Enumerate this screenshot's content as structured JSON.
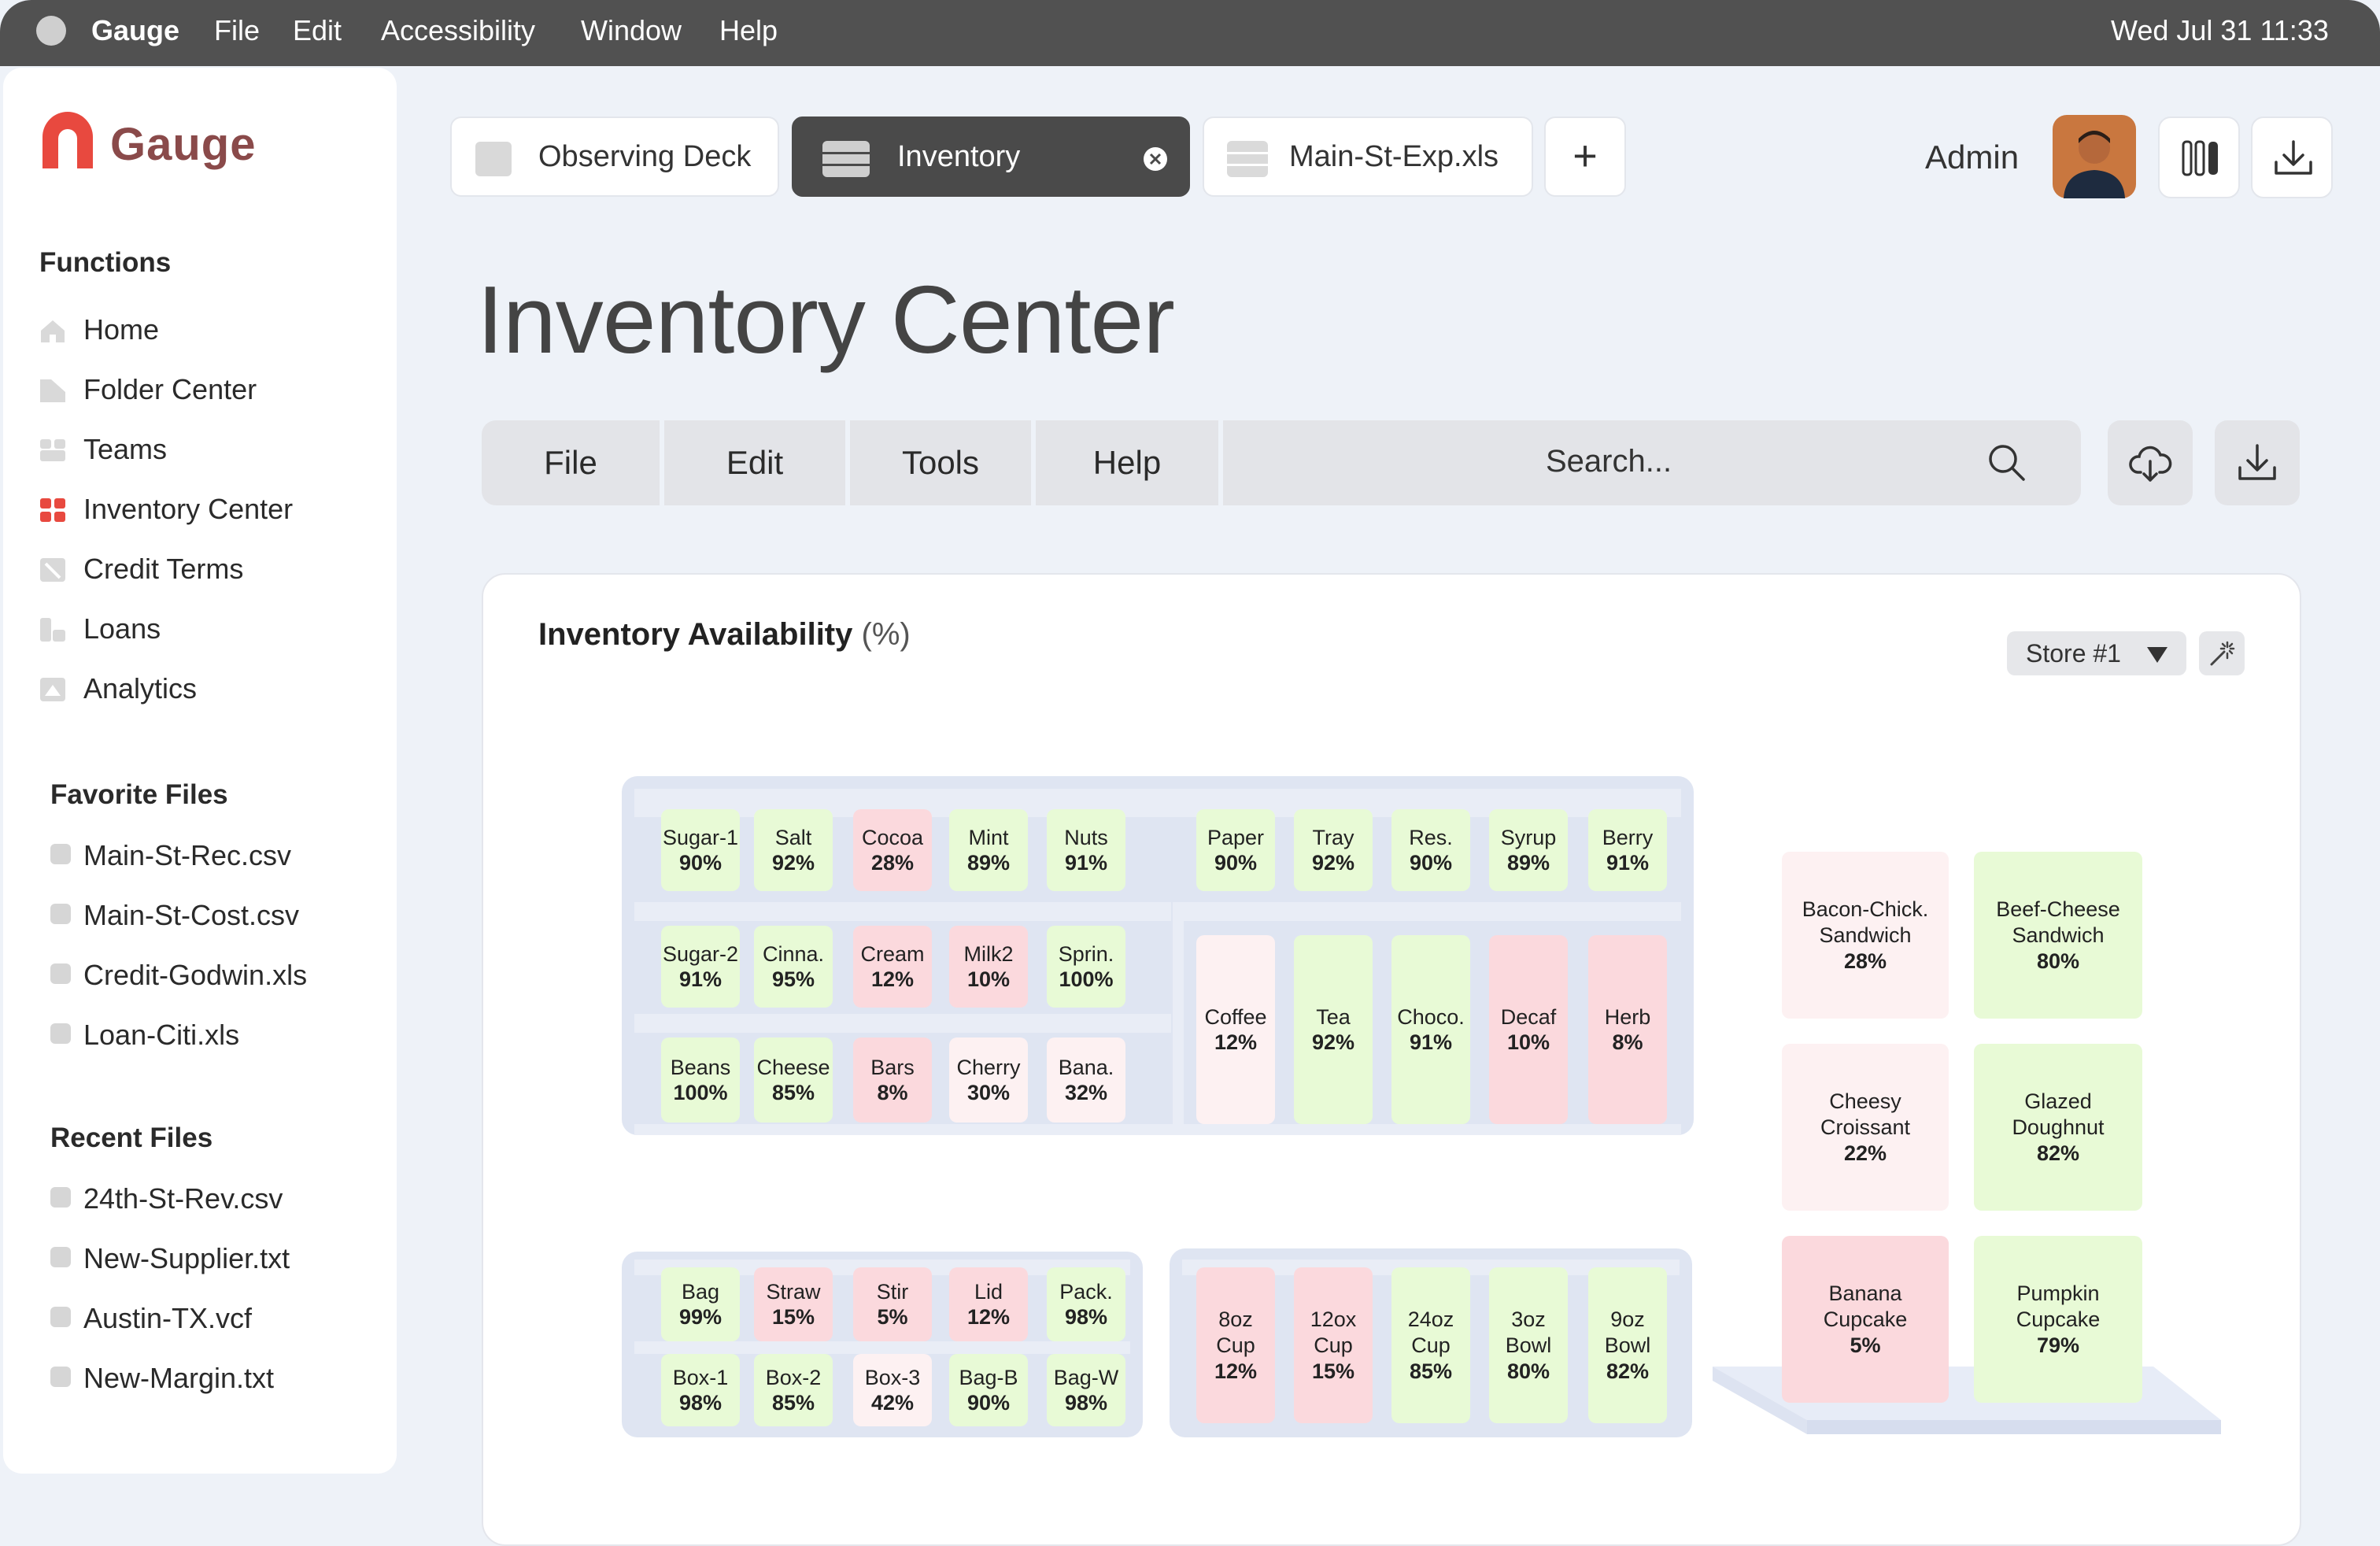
{
  "menubar": {
    "app": "Gauge",
    "items": [
      "File",
      "Edit",
      "Accessibility",
      "Window",
      "Help"
    ],
    "datetime": "Wed Jul 31  11:33"
  },
  "sidebar": {
    "brand": "Gauge",
    "functions_title": "Functions",
    "functions": [
      {
        "label": "Home",
        "icon": "home-icon"
      },
      {
        "label": "Folder Center",
        "icon": "folder-icon"
      },
      {
        "label": "Teams",
        "icon": "teams-icon"
      },
      {
        "label": "Inventory Center",
        "icon": "grid-icon",
        "active": true
      },
      {
        "label": "Credit Terms",
        "icon": "credit-icon"
      },
      {
        "label": "Loans",
        "icon": "loans-icon"
      },
      {
        "label": "Analytics",
        "icon": "analytics-icon"
      }
    ],
    "favorites_title": "Favorite Files",
    "favorites": [
      "Main-St-Rec.csv",
      "Main-St-Cost.csv",
      "Credit-Godwin.xls",
      "Loan-Citi.xls"
    ],
    "recent_title": "Recent Files",
    "recent": [
      "24th-St-Rev.csv",
      "New-Supplier.txt",
      "Austin-TX.vcf",
      "New-Margin.txt"
    ]
  },
  "tabs": [
    {
      "label": "Observing Deck"
    },
    {
      "label": "Inventory",
      "active": true
    },
    {
      "label": "Main-St-Exp.xls"
    }
  ],
  "header": {
    "user": "Admin",
    "add_tab": "+"
  },
  "page": {
    "title": "Inventory Center"
  },
  "toolbar": {
    "menus": [
      "File",
      "Edit",
      "Tools",
      "Help"
    ],
    "search_placeholder": "Search..."
  },
  "panel": {
    "title": "Inventory Availability",
    "unit": "(%)",
    "store": "Store #1"
  },
  "shelf_items": {
    "top_left": [
      {
        "name": "Sugar-1",
        "pct": "90%"
      },
      {
        "name": "Salt",
        "pct": "92%"
      },
      {
        "name": "Cocoa",
        "pct": "28%"
      },
      {
        "name": "Mint",
        "pct": "89%"
      },
      {
        "name": "Nuts",
        "pct": "91%"
      },
      {
        "name": "Sugar-2",
        "pct": "91%"
      },
      {
        "name": "Cinna.",
        "pct": "95%"
      },
      {
        "name": "Cream",
        "pct": "12%"
      },
      {
        "name": "Milk2",
        "pct": "10%"
      },
      {
        "name": "Sprin.",
        "pct": "100%"
      },
      {
        "name": "Beans",
        "pct": "100%"
      },
      {
        "name": "Cheese",
        "pct": "85%"
      },
      {
        "name": "Bars",
        "pct": "8%"
      },
      {
        "name": "Cherry",
        "pct": "30%"
      },
      {
        "name": "Bana.",
        "pct": "32%"
      }
    ],
    "top_right_row": [
      {
        "name": "Paper",
        "pct": "90%"
      },
      {
        "name": "Tray",
        "pct": "92%"
      },
      {
        "name": "Res.",
        "pct": "90%"
      },
      {
        "name": "Syrup",
        "pct": "89%"
      },
      {
        "name": "Berry",
        "pct": "91%"
      }
    ],
    "top_right_tall": [
      {
        "name": "Coffee",
        "pct": "12%"
      },
      {
        "name": "Tea",
        "pct": "92%"
      },
      {
        "name": "Choco.",
        "pct": "91%"
      },
      {
        "name": "Decaf",
        "pct": "10%"
      },
      {
        "name": "Herb",
        "pct": "8%"
      }
    ],
    "bottom_left": [
      {
        "name": "Bag",
        "pct": "99%"
      },
      {
        "name": "Straw",
        "pct": "15%"
      },
      {
        "name": "Stir",
        "pct": "5%"
      },
      {
        "name": "Lid",
        "pct": "12%"
      },
      {
        "name": "Pack.",
        "pct": "98%"
      },
      {
        "name": "Box-1",
        "pct": "98%"
      },
      {
        "name": "Box-2",
        "pct": "85%"
      },
      {
        "name": "Box-3",
        "pct": "42%"
      },
      {
        "name": "Bag-B",
        "pct": "90%"
      },
      {
        "name": "Bag-W",
        "pct": "98%"
      }
    ],
    "bottom_mid": [
      {
        "name": "8oz",
        "name2": "Cup",
        "pct": "12%"
      },
      {
        "name": "12ox",
        "name2": "Cup",
        "pct": "15%"
      },
      {
        "name": "24oz",
        "name2": "Cup",
        "pct": "85%"
      },
      {
        "name": "3oz",
        "name2": "Bowl",
        "pct": "80%"
      },
      {
        "name": "9oz",
        "name2": "Bowl",
        "pct": "82%"
      }
    ],
    "display_case": [
      {
        "name": "Bacon-Chick.",
        "name2": "Sandwich",
        "pct": "28%"
      },
      {
        "name": "Beef-Cheese",
        "name2": "Sandwich",
        "pct": "80%"
      },
      {
        "name": "Cheesy",
        "name2": "Croissant",
        "pct": "22%"
      },
      {
        "name": "Glazed",
        "name2": "Doughnut",
        "pct": "82%"
      },
      {
        "name": "Banana",
        "name2": "Cupcake",
        "pct": "5%"
      },
      {
        "name": "Pumpkin",
        "name2": "Cupcake",
        "pct": "79%"
      }
    ]
  },
  "colors": {
    "high": "#e8fad6",
    "low": "#fbd9dd",
    "mid": "#fdf1f2",
    "accent": "#e8493f"
  }
}
